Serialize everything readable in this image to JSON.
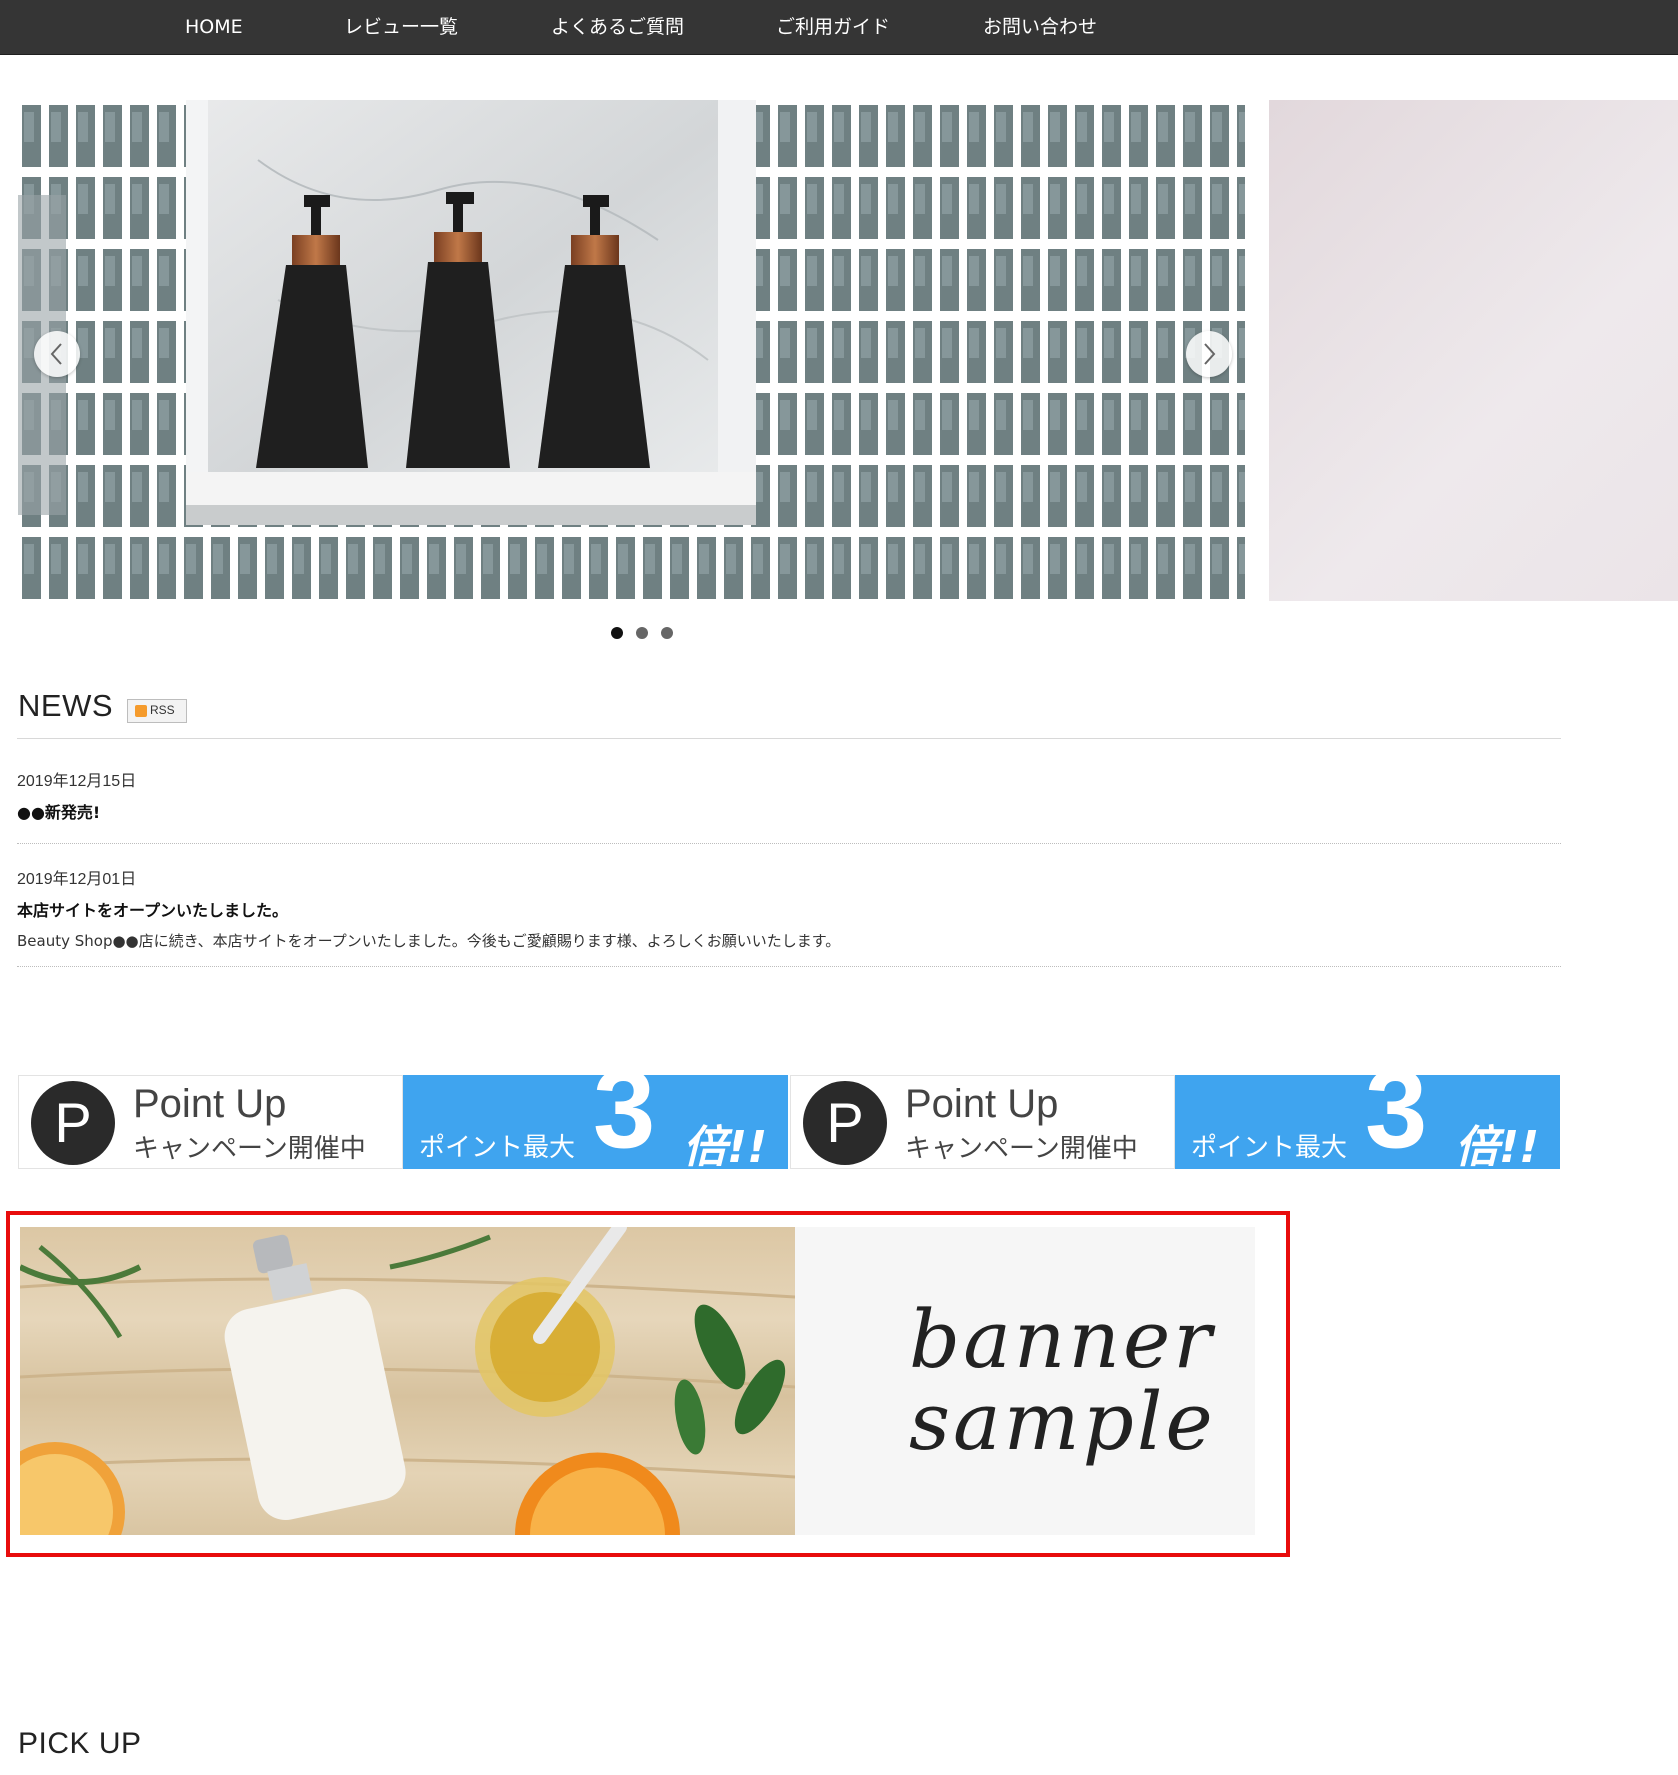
{
  "nav": {
    "items": [
      {
        "label": "HOME"
      },
      {
        "label": "レビュー一覧"
      },
      {
        "label": "よくあるご質問"
      },
      {
        "label": "ご利用ガイド"
      },
      {
        "label": "お問い合わせ"
      }
    ]
  },
  "slider": {
    "current_slide": 1,
    "slide_count": 3
  },
  "news": {
    "title": "NEWS",
    "rss_label": "RSS",
    "items": [
      {
        "date": "2019年12月15日",
        "headline": "●●新発売!",
        "body": ""
      },
      {
        "date": "2019年12月01日",
        "headline": "本店サイトをオープンいたしました。",
        "body": "Beauty Shop●●店に続き、本店サイトをオープンいたしました。今後もご愛顧賜ります様、よろしくお願いいたします。"
      }
    ]
  },
  "point_banner": {
    "circle_letter": "P",
    "title": "Point Up",
    "subtitle": "キャンペーン開催中",
    "right_text": "ポイント最大",
    "big_number": "3",
    "suffix": "倍!!",
    "colors": {
      "blue": "#3fa4ef",
      "dark": "#2a2a2a"
    }
  },
  "sample_banner": {
    "line1": "banner",
    "line2": "sample",
    "highlight_color": "#e80c0c"
  },
  "pickup": {
    "title": "PICK UP"
  }
}
